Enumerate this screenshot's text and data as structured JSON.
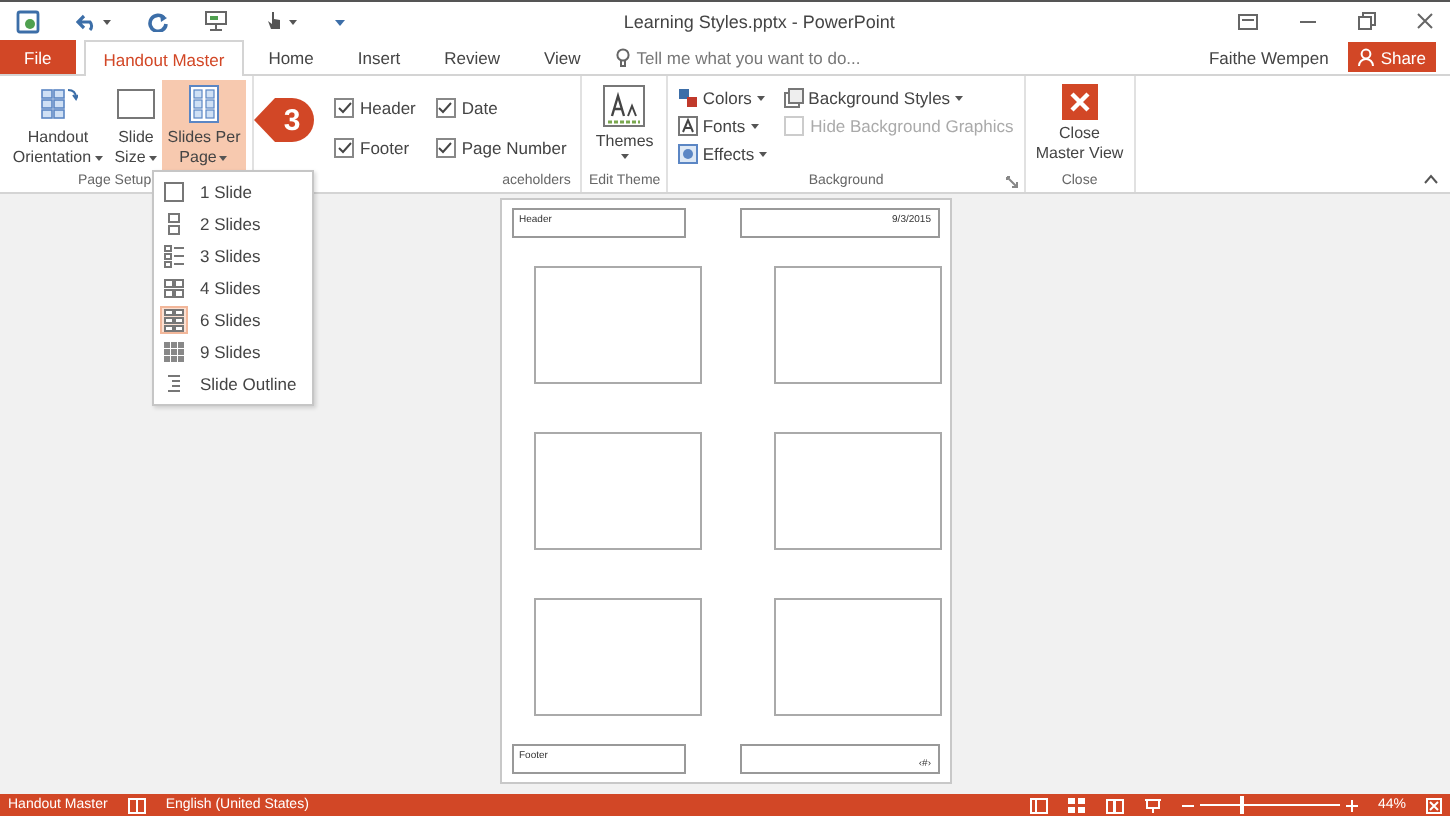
{
  "window": {
    "title": "Learning Styles.pptx - PowerPoint"
  },
  "tabs": [
    {
      "label": "File",
      "kind": "file",
      "selected": false
    },
    {
      "label": "Handout Master",
      "kind": "tab",
      "selected": true
    },
    {
      "label": "Home",
      "kind": "tab",
      "selected": false
    },
    {
      "label": "Insert",
      "kind": "tab",
      "selected": false
    },
    {
      "label": "Review",
      "kind": "tab",
      "selected": false
    },
    {
      "label": "View",
      "kind": "tab",
      "selected": false
    }
  ],
  "tell_me": {
    "placeholder": "Tell me what you want to do..."
  },
  "user": {
    "name": "Faithe Wempen"
  },
  "share_button": {
    "label": "Share"
  },
  "ribbon_groups": [
    {
      "label": "Page Setup",
      "kind": "buttons",
      "items": [
        {
          "kind": "large",
          "label": "Handout Orientation",
          "selected": false
        },
        {
          "kind": "large",
          "label": "Slide Size",
          "selected": false
        },
        {
          "kind": "large",
          "label": "Slides Per Page",
          "selected": true
        }
      ]
    },
    {
      "label": "aceholders",
      "kind": "checks",
      "items": [
        {
          "kind": "check",
          "label": "Header",
          "checked": true,
          "disabled": false
        },
        {
          "kind": "check",
          "label": "Footer",
          "checked": true,
          "disabled": false
        },
        {
          "kind": "check",
          "label": "Date",
          "checked": true,
          "disabled": false
        },
        {
          "kind": "check",
          "label": "Page Number",
          "checked": true,
          "disabled": false
        }
      ]
    },
    {
      "label": "Edit Theme",
      "kind": "buttons",
      "items": [
        {
          "kind": "large",
          "label": "Themes",
          "selected": false
        }
      ]
    },
    {
      "label": "Background",
      "kind": "stack",
      "items": [
        {
          "kind": "small",
          "label": "Colors"
        },
        {
          "kind": "small",
          "label": "Fonts"
        },
        {
          "kind": "small",
          "label": "Effects"
        },
        {
          "kind": "small",
          "label": "Background Styles"
        },
        {
          "kind": "check",
          "label": "Hide Background Graphics",
          "checked": false,
          "disabled": true
        }
      ]
    },
    {
      "label": "Close",
      "kind": "buttons",
      "items": [
        {
          "kind": "close",
          "label": "Close Master View",
          "selected": false
        }
      ]
    }
  ],
  "slides_per_page_menu": [
    {
      "label": "1 Slide",
      "selected": false
    },
    {
      "label": "2 Slides",
      "selected": false
    },
    {
      "label": "3 Slides",
      "selected": false
    },
    {
      "label": "4 Slides",
      "selected": false
    },
    {
      "label": "6 Slides",
      "selected": true
    },
    {
      "label": "9 Slides",
      "selected": false
    },
    {
      "label": "Slide Outline",
      "selected": false
    }
  ],
  "callout": {
    "label": "3"
  },
  "handout": {
    "header": "Header",
    "date": "9/3/2015",
    "footer": "Footer",
    "page_number": "‹#›"
  },
  "status_bar": {
    "mode": "Handout Master",
    "language": "English (United States)",
    "zoom": {
      "level": 0.3,
      "reading": "44%"
    }
  }
}
